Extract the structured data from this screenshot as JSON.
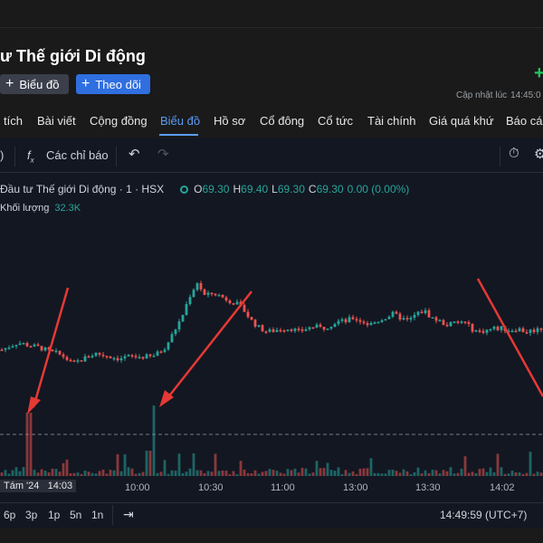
{
  "header": {
    "title": "ư Thế giới Di động",
    "chart_button": "Biểu đồ",
    "follow_button": "Theo dõi",
    "update_label": "Cập nhật lúc",
    "update_time": "14:45:0"
  },
  "tabs": [
    "tích",
    "Bài viết",
    "Cộng đồng",
    "Biểu đồ",
    "Hồ sơ",
    "Cổ đông",
    "Cổ tức",
    "Tài chính",
    "Giá quá khứ",
    "Báo các"
  ],
  "active_tab": "Biểu đồ",
  "toolbar": {
    "indicators_label": "Các chỉ báo"
  },
  "legend": {
    "symbol": "Đầu tư Thế giới Di động · 1 · HSX",
    "open_key": "O",
    "open": "69.30",
    "high_key": "H",
    "high": "69.40",
    "low_key": "L",
    "low": "69.30",
    "close_key": "C",
    "close": "69.30",
    "change": "0.00 (0.00%)",
    "volume_label": "Khối lượng",
    "volume": "32.3K"
  },
  "colors": {
    "up": "#26a69a",
    "down": "#ef5350",
    "accent": "#2962ff",
    "annotation": "#e53935"
  },
  "chart_data": {
    "type": "candlestick",
    "x_ticks": [
      "Tám '24",
      "14:03",
      "10:00",
      "10:30",
      "11:00",
      "13:00",
      "13:30",
      "14:02"
    ],
    "price_path": [
      67.4,
      67.5,
      67.6,
      67.55,
      67.5,
      67.45,
      67.35,
      67.3,
      67.2,
      67.0,
      67.1,
      67.2,
      67.3,
      67.25,
      67.2,
      67.15,
      67.2,
      67.2,
      67.2,
      67.2,
      67.3,
      67.5,
      67.9,
      68.3,
      68.9,
      69.3,
      68.9,
      69.0,
      68.9,
      68.8,
      68.7,
      68.5,
      68.2,
      68.0,
      67.9,
      67.95,
      68.0,
      68.0,
      67.9,
      68.0,
      68.05,
      68.0,
      68.1,
      68.2,
      68.2,
      68.3,
      68.2,
      68.1,
      68.2,
      68.3,
      68.4,
      68.3,
      68.2,
      68.4,
      68.5,
      68.3,
      68.2,
      68.1,
      68.15,
      68.2,
      68.0,
      67.9,
      67.95,
      68.0,
      68.0,
      67.95,
      68.0,
      67.9,
      67.95,
      68.0
    ],
    "volume_spikes": [
      {
        "time": "09:15",
        "note": "large volume bar"
      },
      {
        "time": "10:05",
        "note": "large volume bar"
      }
    ],
    "annotations": [
      "red arrow pointing to volume spike near 09:15",
      "red arrow pointing to volume spike near 10:05",
      "red arrow at right edge"
    ]
  },
  "range_buttons": [
    "6p",
    "3p",
    "1p",
    "5n",
    "1n"
  ],
  "clock": "14:49:59 (UTC+7)"
}
